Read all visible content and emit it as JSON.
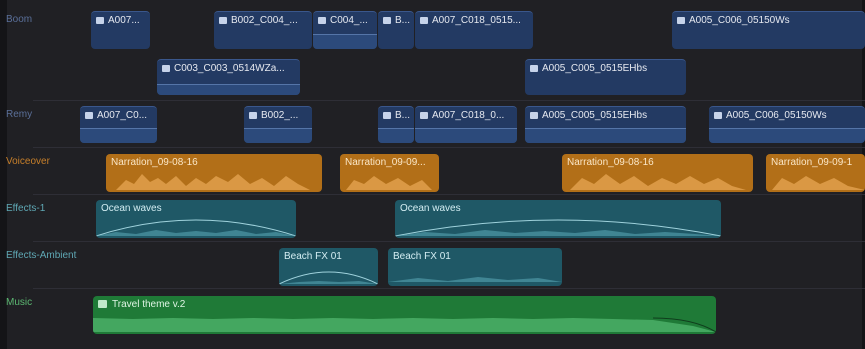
{
  "colors": {
    "background": "#202024",
    "video_clip": "#233a63",
    "voiceover_clip": "#b26f18",
    "effects_clip": "#1f5866",
    "music_clip": "#1f7a37",
    "roles": {
      "boom": "#5a6f99",
      "remy": "#5a6f99",
      "voiceover": "#c77f2a",
      "effects": "#5fa8b5",
      "music": "#5cb872"
    }
  },
  "lanes": {
    "boom": {
      "label": "Boom",
      "clips": [
        "A007...",
        "B002_C004_...",
        "C004_...",
        "B...",
        "A007_C018_0515...",
        "A005_C006_05150Ws",
        "C003_C003_0514WZa...",
        "A005_C005_0515EHbs"
      ]
    },
    "remy": {
      "label": "Remy",
      "clips": [
        "A007_C0...",
        "B002_...",
        "B...",
        "A007_C018_0...",
        "A005_C005_0515EHbs",
        "A005_C006_05150Ws"
      ]
    },
    "voiceover": {
      "label": "Voiceover",
      "clips": [
        "Narration_09-08-16",
        "Narration_09-09...",
        "Narration_09-08-16",
        "Narration_09-09-1"
      ]
    },
    "effects1": {
      "label": "Effects-1",
      "clips": [
        "Ocean waves",
        "Ocean waves"
      ]
    },
    "effects_ambient": {
      "label": "Effects-Ambient",
      "clips": [
        "Beach FX 01",
        "Beach FX 01"
      ]
    },
    "music": {
      "label": "Music",
      "clips": [
        "Travel theme v.2"
      ]
    }
  }
}
